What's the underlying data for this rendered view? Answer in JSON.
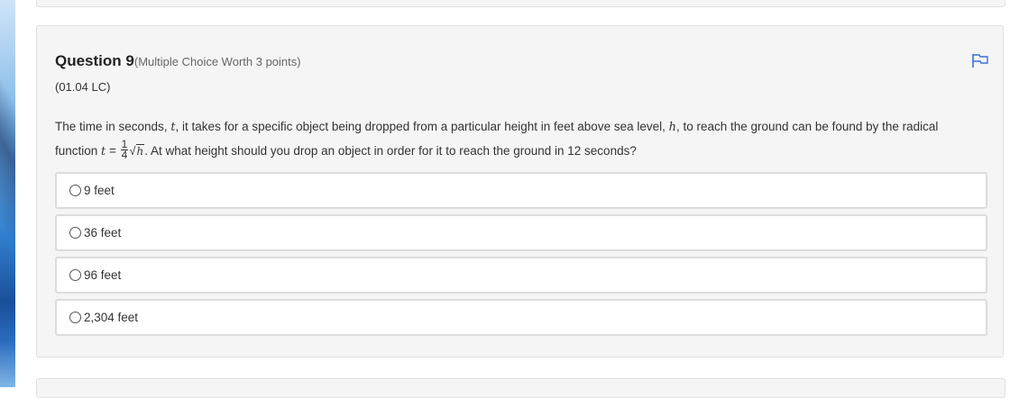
{
  "question": {
    "title": "Question 9",
    "meta": "(Multiple Choice Worth 3 points)",
    "code": "(01.04 LC)",
    "text_part1": "The time in seconds, ",
    "var_t": "t",
    "text_part2": ", it takes for a specific object being dropped from a particular height in feet above sea level, ",
    "var_h": "h",
    "text_part3": ", to reach the ground can be found by the radical",
    "text_part4": "function ",
    "eq_t": "t",
    "eq_equals": " = ",
    "frac_num": "1",
    "frac_den": "4",
    "sqrt_symbol": "√",
    "radicand": "h",
    "text_part5": ". At what height should you drop an object in order for it to reach the ground in 12 seconds?"
  },
  "options": [
    {
      "label": "9 feet"
    },
    {
      "label": "36 feet"
    },
    {
      "label": "96 feet"
    },
    {
      "label": "2,304 feet"
    }
  ],
  "icons": {
    "flag": "flag-icon",
    "flag_color": "#3a6fd8"
  }
}
